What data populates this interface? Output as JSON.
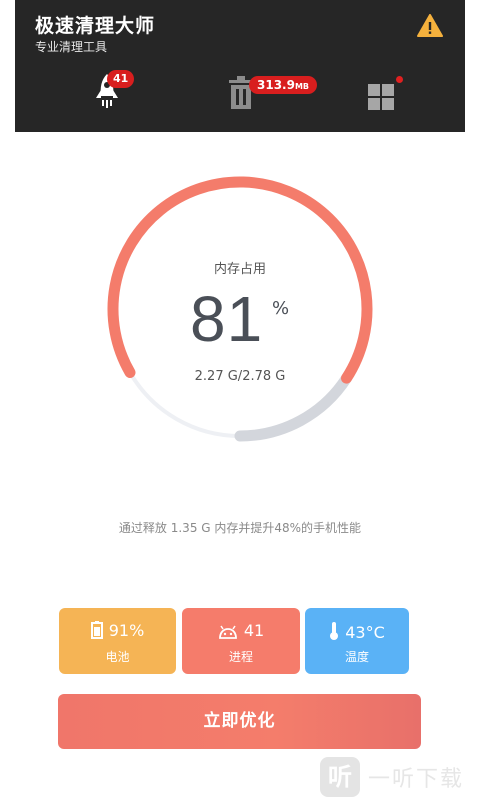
{
  "header": {
    "title": "极速清理大师",
    "subtitle": "专业清理工具"
  },
  "toolbar": {
    "rocket_badge": "41",
    "trash_badge_value": "313.9",
    "trash_badge_unit": "MB"
  },
  "memory": {
    "label": "内存占用",
    "percent": "81",
    "percent_unit": "%",
    "usage": "2.27 G/2.78 G",
    "fraction_used": 0.81
  },
  "tip": "通过释放 1.35 G 内存并提升48%的手机性能",
  "stats": {
    "battery": {
      "value": "91%",
      "label": "电池"
    },
    "process": {
      "value": "41",
      "label": "进程"
    },
    "temperature": {
      "value": "43°C",
      "label": "温度"
    }
  },
  "action": {
    "label": "立即优化"
  },
  "watermark": {
    "logo": "听",
    "text": "一听下载"
  },
  "colors": {
    "header_bg": "#262626",
    "accent": "#f47c6b",
    "gauge_remaining": "#d3d6dc",
    "battery": "#f5b455",
    "process": "#f57c6b",
    "temperature": "#5ab2f6"
  },
  "icons": {
    "warning": "warning-icon",
    "rocket": "rocket-icon",
    "trash": "trash-icon",
    "grid": "grid-icon",
    "battery": "battery-icon",
    "process": "android-icon",
    "temperature": "thermometer-icon"
  }
}
